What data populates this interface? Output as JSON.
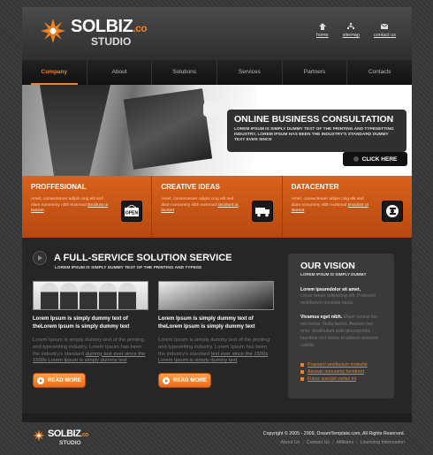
{
  "brand": {
    "name": "SOLBIZ",
    "suffix": ".co",
    "sub": "STUDIO",
    "accent": "#f08020"
  },
  "toplinks": [
    {
      "label": "home",
      "icon": "home-icon"
    },
    {
      "label": "sitemap",
      "icon": "sitemap-icon"
    },
    {
      "label": "contact us",
      "icon": "mail-icon"
    }
  ],
  "nav": [
    "Company",
    "About",
    "Solutions",
    "Services",
    "Partners",
    "Contacts"
  ],
  "banner": {
    "title": "ONLINE BUSINESS CONSULTATION",
    "text": "LOREM IPSUM IS SIMPLY DUMMY TEXT OF THE PRINTING AND TYPESETTING INDUSTRY. LOREM IPSUM HAS BEEN THE INDUSTRY'S STANDARD DUMMY TEXT EVER SINCE",
    "button": "CLICK HERE"
  },
  "features": [
    {
      "title": "PROFFESIONAL",
      "text": "Amet, consectetuer adipis cing elit sed diam nonummy nibh euismod ",
      "link": "tincidunt ut laoreet",
      "icon": "open-sign-icon"
    },
    {
      "title": "CREATIVE IDEAS",
      "text": "Amet, consectetuer adipis cing elit sed diam nonummy nibh euismod ",
      "link": "tincidunt ut laoreet",
      "icon": "truck-icon"
    },
    {
      "title": "DATACENTER",
      "text": "Amet, consectetuer adipis cing elit sed diam nonummy nibh euismod ",
      "link": "tincidunt ut laoreet",
      "icon": "disk-icon"
    }
  ],
  "main": {
    "title": "A FULL-SERVICE SOLUTION SERVICE",
    "subtitle": "LOREM IPSUM IS SIMPLY DUMMY TEXT OF THE PRINTING AND TYPESE",
    "columns": [
      {
        "bold": "Lorem Ipsum is simply dummy text of theLorem Ipsum is simply dummy text",
        "text": "Lorem Ipsum is simply dummy text of the printing and typesetting industry. Lorem Ipsum has been the industry's standard ",
        "link": "dummy text ever since the 1500s Lorem Ipsum is simply dummy text",
        "button": "READ MORE"
      },
      {
        "bold": "Lorem Ipsum is simply dummy text of theLorem Ipsum is simply dummy text",
        "text": "Lorem Ipsum is simply dummy text of the printing and typesetting industry. Lorem Ipsum has been the industry's standard ",
        "link": "text ever since the 1500s Lorem Ipsum is simply dummy text",
        "button": "READ MORE"
      }
    ]
  },
  "vision": {
    "title": "OUR VISION",
    "subtitle": "LOREM IPSUM IS SIMPLY DUMMY",
    "block1_bold": "Lorem ipsumdolor sit amet,",
    "block1_text": "conse tetuer adipiscing elit. Praesent vestibulum molestie lacus.",
    "block2_bold": "Vivamus eget nibh.",
    "block2_text": " Etiam cursus leo vel metus. Nulla facilisi. Aenean nec eros. Vestibulum ante ipsumprimis faucibus orci luctus et ultrices posuere cubilia.",
    "links": [
      "Praesent vestibulum molestie",
      "Aenean nonummy hendrerit",
      "Fusce suscipit varius mi"
    ]
  },
  "footer": {
    "copyright": "Copyright © 2005 - 2009, DreamTemplate.com, All Rights Reserved.",
    "links": [
      "About Us",
      "Contact Us",
      "Affiliates",
      "Licensing Information"
    ]
  }
}
